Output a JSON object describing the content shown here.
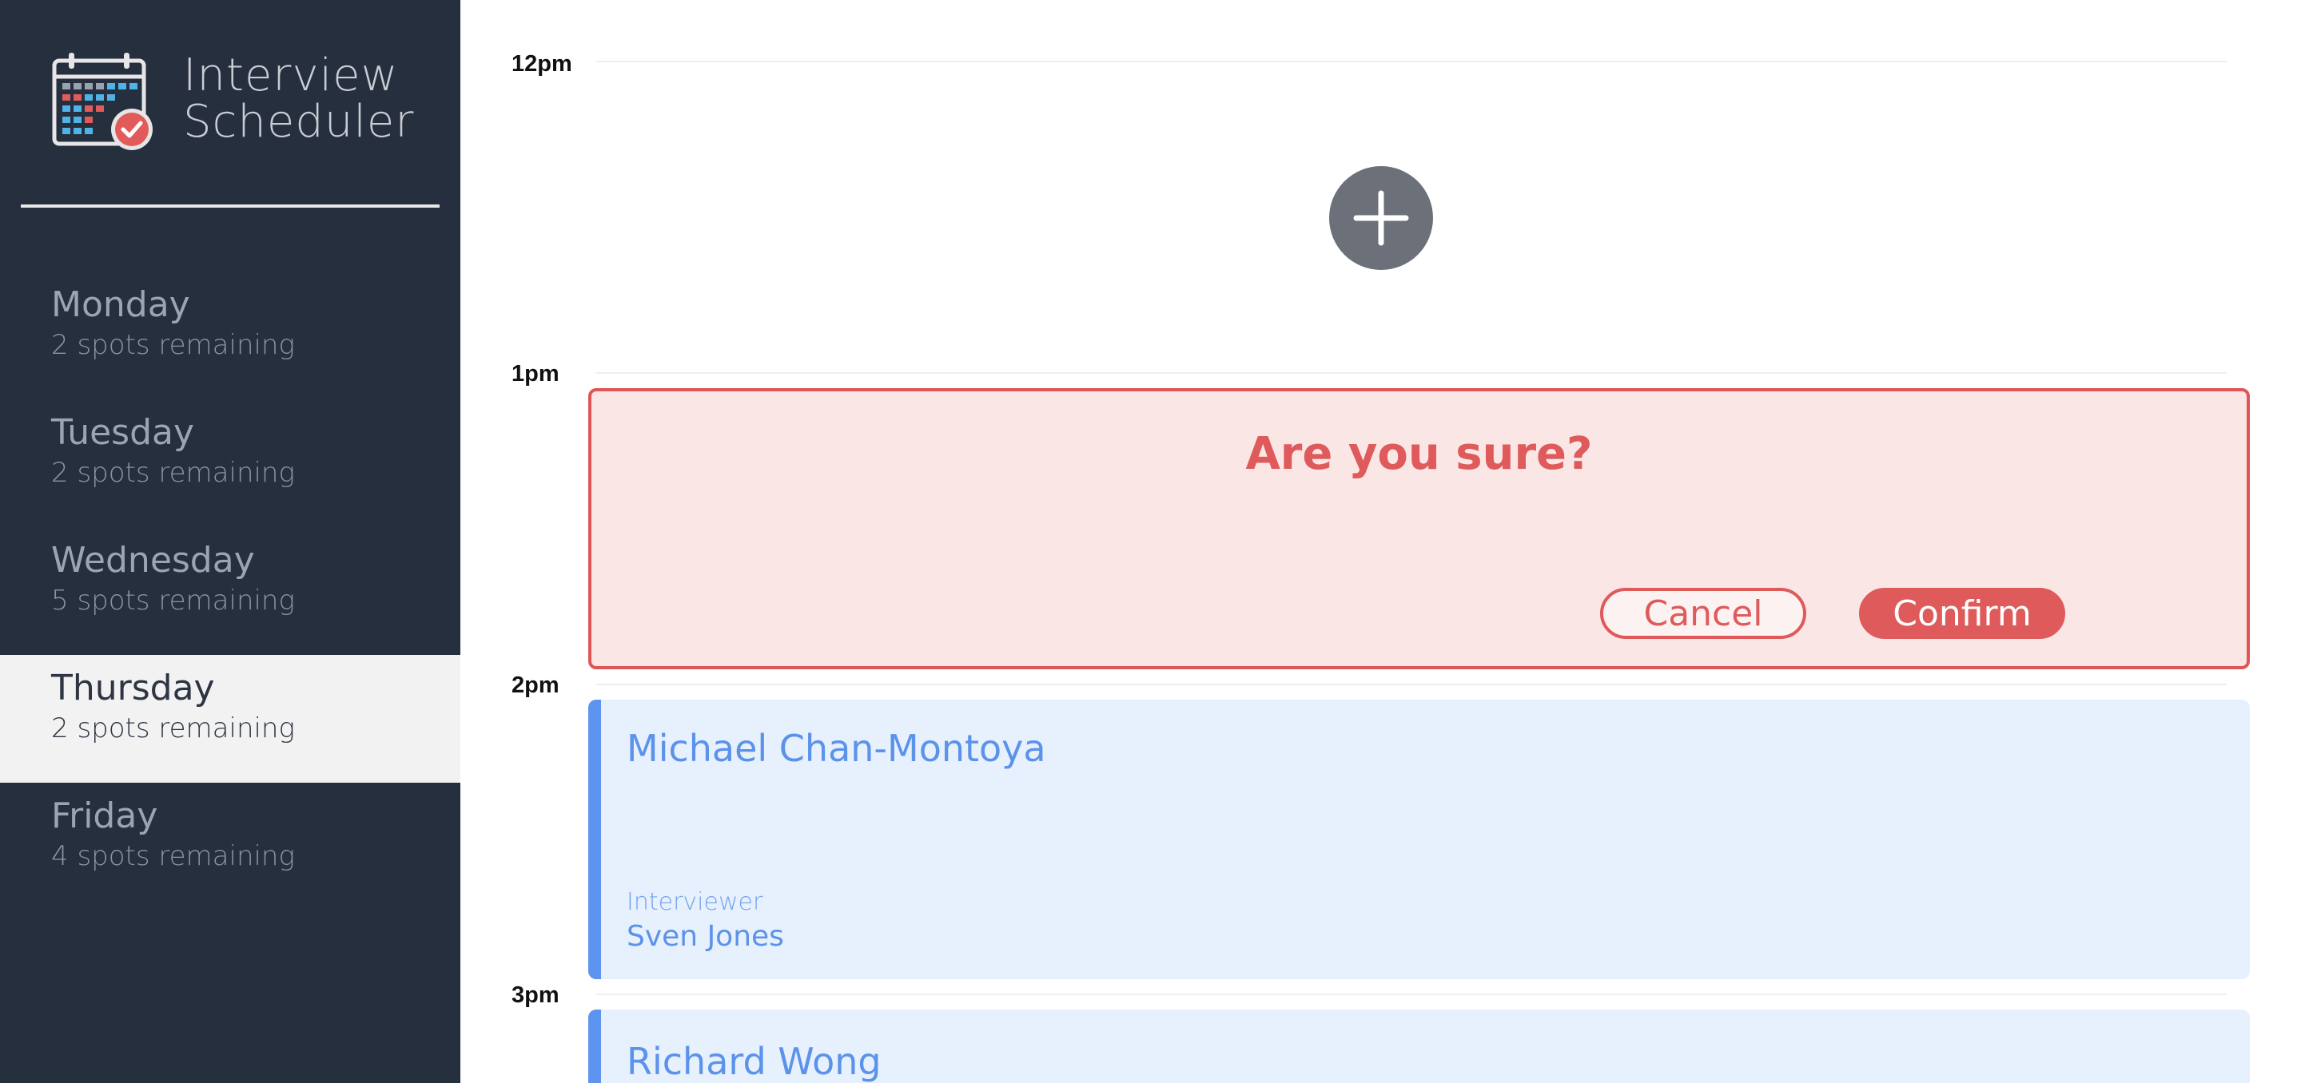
{
  "app": {
    "title_line1": "Interview",
    "title_line2": "Scheduler",
    "logo_icon": "calendar-check-icon"
  },
  "days": [
    {
      "name": "Monday",
      "spots": "2 spots remaining",
      "selected": false
    },
    {
      "name": "Tuesday",
      "spots": "2 spots remaining",
      "selected": false
    },
    {
      "name": "Wednesday",
      "spots": "5 spots remaining",
      "selected": false
    },
    {
      "name": "Thursday",
      "spots": "2 spots remaining",
      "selected": true
    },
    {
      "name": "Friday",
      "spots": "4 spots remaining",
      "selected": false
    }
  ],
  "times": [
    "12pm",
    "1pm",
    "2pm",
    "3pm"
  ],
  "add_icon": "plus-icon",
  "confirm": {
    "message": "Are you sure?",
    "cancel": "Cancel",
    "confirm": "Confirm"
  },
  "appointments": [
    {
      "student": "Michael Chan-Montoya",
      "label": "Interviewer",
      "interviewer": "Sven Jones"
    },
    {
      "student": "Richard Wong"
    }
  ],
  "colors": {
    "sidebar": "#252f3e",
    "danger": "#df5a5a",
    "appointment_accent": "#5d94ef",
    "appointment_bg": "#e7f0fd"
  }
}
